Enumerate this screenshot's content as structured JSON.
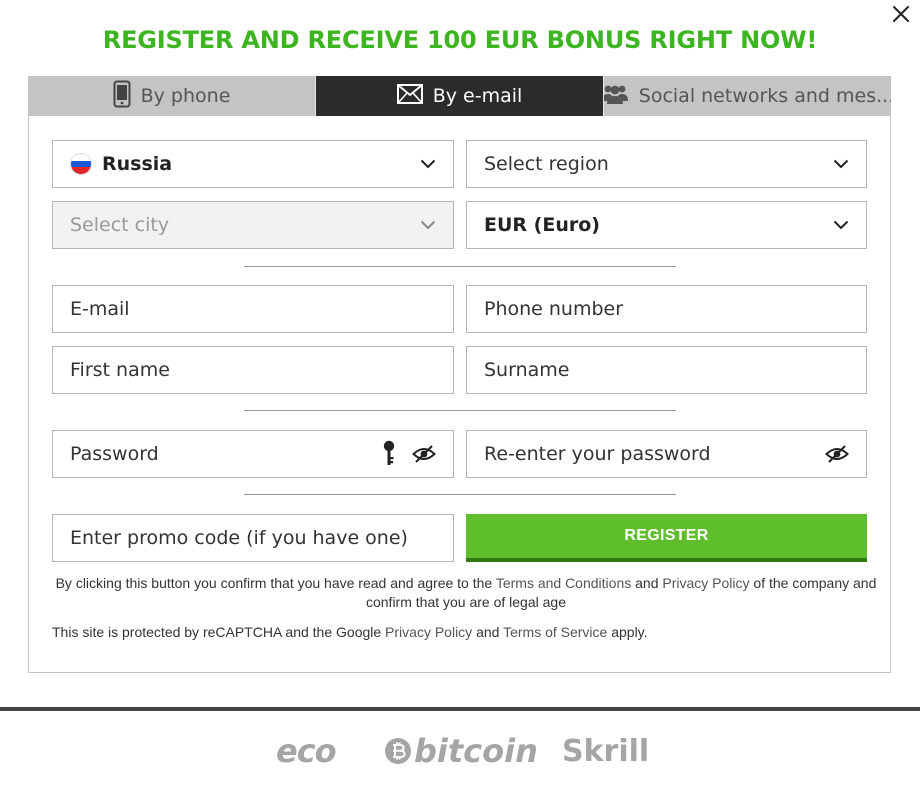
{
  "headline": "REGISTER AND RECEIVE 100 EUR BONUS RIGHT NOW!",
  "tabs": [
    {
      "label": "By phone",
      "icon": "phone-icon"
    },
    {
      "label": "By e-mail",
      "icon": "envelope-icon",
      "active": true
    },
    {
      "label": "Social networks and mes...",
      "icon": "users-icon"
    }
  ],
  "form": {
    "country": "Russia",
    "region_placeholder": "Select region",
    "city_placeholder": "Select city",
    "currency": "EUR (Euro)",
    "email_placeholder": "E-mail",
    "phone_placeholder": "Phone number",
    "first_name_placeholder": "First name",
    "surname_placeholder": "Surname",
    "password_placeholder": "Password",
    "reenter_password_placeholder": "Re-enter your password",
    "promo_placeholder": "Enter promo code (if you have one)",
    "register_label": "REGISTER"
  },
  "terms": {
    "prefix": "By clicking this button you confirm that you have read and agree to the ",
    "terms_link": "Terms and Conditions",
    "middle": " and ",
    "privacy_link": "Privacy Policy",
    "suffix": " of the company and confirm that you are of legal age"
  },
  "recaptcha": {
    "prefix": "This site is protected by reCAPTCHA and the Google ",
    "privacy_link": "Privacy Policy",
    "middle": " and ",
    "tos_link": "Terms of Service",
    "suffix": " apply."
  },
  "payment_logos": [
    "eco",
    "bitcoin",
    "Skrill"
  ],
  "colors": {
    "headline": "#3cb521",
    "register_button": "#5fbe2c",
    "active_tab": "#2b2b2b",
    "inactive_tab": "#c4c4c4"
  }
}
